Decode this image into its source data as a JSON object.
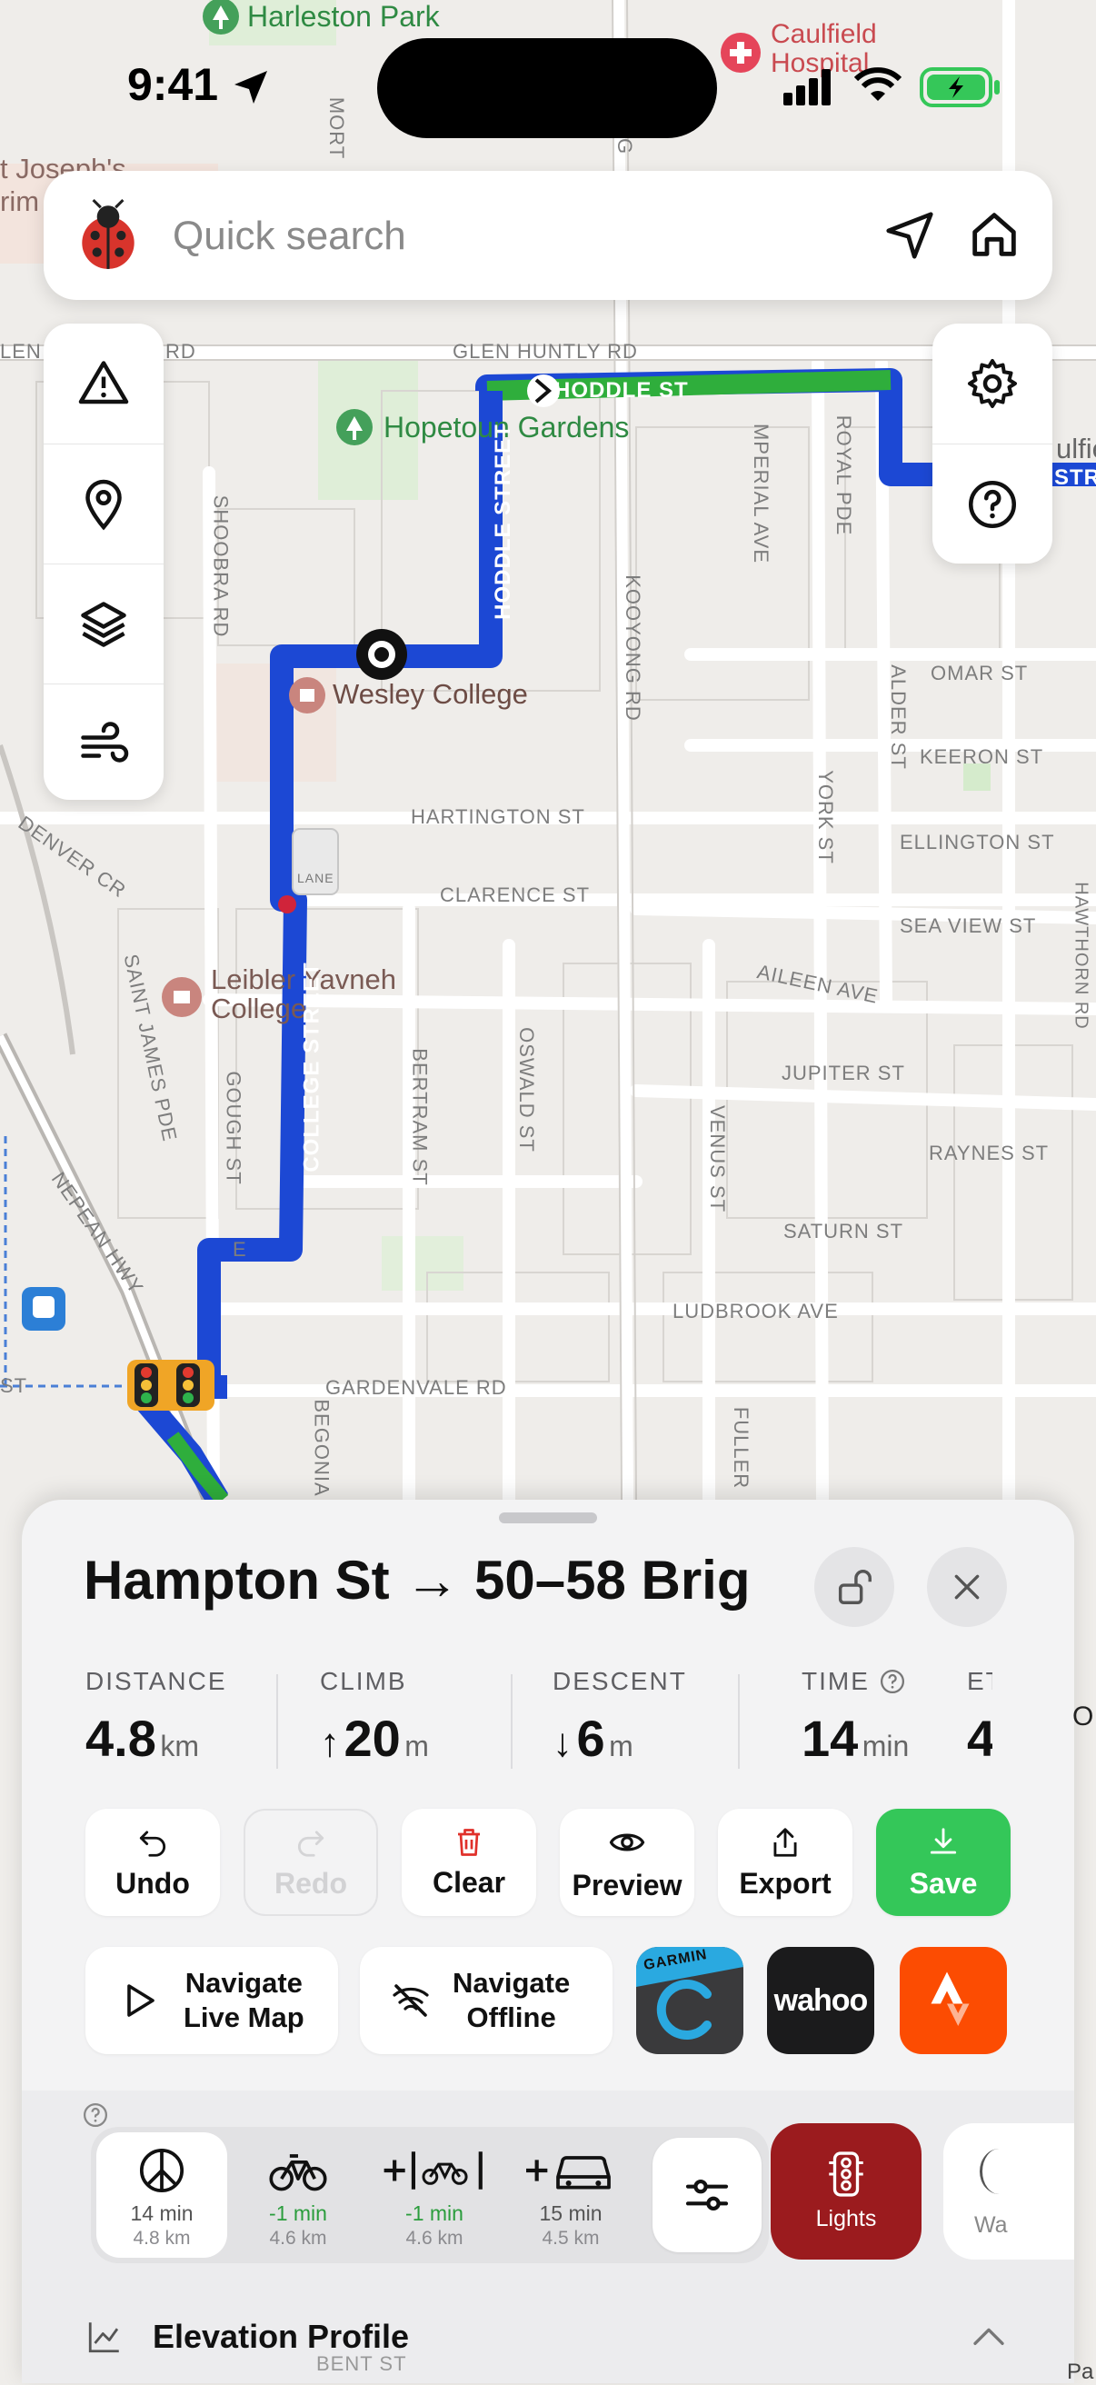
{
  "status_bar": {
    "time": "9:41"
  },
  "search": {
    "placeholder": "Quick search"
  },
  "map": {
    "pois": {
      "harleston_park": "Harleston Park",
      "caulfield_hospital": "Caulfield\nHospital",
      "st_josephs": "t Joseph's\nrim",
      "hopetoun_gardens": "Hopetoun Gardens",
      "wesley_college": "Wesley College",
      "leibler_yavneh": "Leibler Yavneh\nCollege",
      "caulfield_right": "ulfie"
    },
    "streets": {
      "glen_huntly": "GLEN HUNTLY RD",
      "glen_huntly_left": "LEN",
      "glen_huntly_mid": "RD",
      "hoddle_st": "HODDLE ST",
      "hoddle_street": "HODDLE STREET",
      "college_street": "COLLEGE STREET",
      "imperial_ave": "MPERIAL AVE",
      "royal_pde": "ROYAL PDE",
      "kooyong_rd": "KOOYONG RD",
      "shoobra_rd": "SHOOBRA RD",
      "omar_st": "OMAR ST",
      "keeron_st": "KEERON ST",
      "ellington_st": "ELLINGTON ST",
      "sea_view_st": "SEA VIEW ST",
      "hartington_st": "HARTINGTON ST",
      "clarence_st": "CLARENCE ST",
      "alder_st": "ALDER ST",
      "york_st": "YORK ST",
      "aileen_ave": "AILEEN AVE",
      "jupiter_st": "JUPITER ST",
      "raynes_st": "RAYNES ST",
      "saturn_st": "SATURN ST",
      "ludbrook_ave": "LUDBROOK AVE",
      "gardenvale_rd": "GARDENVALE RD",
      "denver_cr": "DENVER CR",
      "saint_james_pde": "SAINT JAMES PDE",
      "gough_st": "GOUGH ST",
      "bertram_st": "BERTRAM ST",
      "oswald_st": "OSWALD ST",
      "venus_st": "VENUS ST",
      "nepean_hwy": "NEPEAN HWY",
      "fuller": "FULLER",
      "begonia": "BEGONIA",
      "hawthorn_rd": "HAWTHORN RD",
      "mort": "MORT",
      "bent_st": "BENT ST",
      "st_left": "ST",
      "e_label": "E",
      "str_right": "STR",
      "g_label": "G",
      "o_right": "O",
      "pa_right": "Pa",
      "lane": "LANE"
    }
  },
  "route": {
    "title": "Hampton St → 50–58 Brig",
    "stats": [
      {
        "label": "DISTANCE",
        "value": "4.8",
        "unit": "km",
        "arrow": ""
      },
      {
        "label": "CLIMB",
        "value": "20",
        "unit": "m",
        "arrow": "↑"
      },
      {
        "label": "DESCENT",
        "value": "6",
        "unit": "m",
        "arrow": "↓"
      },
      {
        "label": "TIME",
        "value": "14",
        "unit": "min",
        "arrow": ""
      },
      {
        "label": "ET",
        "value": "4",
        "unit": "",
        "arrow": ""
      }
    ],
    "actions": {
      "undo": "Undo",
      "redo": "Redo",
      "clear": "Clear",
      "preview": "Preview",
      "export": "Export",
      "save": "Save"
    },
    "navigate_live": "Navigate\nLive Map",
    "navigate_offline": "Navigate\nOffline",
    "apps": {
      "garmin": "GARMIN",
      "wahoo": "wahoo"
    },
    "modes": [
      {
        "icon": "peace-icon",
        "time": "14 min",
        "dist": "4.8 km",
        "delta": false
      },
      {
        "icon": "bike-icon",
        "time": "-1 min",
        "dist": "4.6 km",
        "delta": true
      },
      {
        "icon": "bike-lane-icon",
        "time": "-1 min",
        "dist": "4.6 km",
        "delta": true
      },
      {
        "icon": "car-icon",
        "time": "15 min",
        "dist": "4.5 km",
        "delta": false
      }
    ],
    "lights_label": "Lights",
    "wa_label": "Wa",
    "elevation_label": "Elevation Profile"
  },
  "colors": {
    "route_blue": "#1c48d4",
    "route_green": "#2fae3c",
    "save_green": "#34c759",
    "lights_red": "#9b1b1e",
    "strava": "#fc4c02"
  }
}
